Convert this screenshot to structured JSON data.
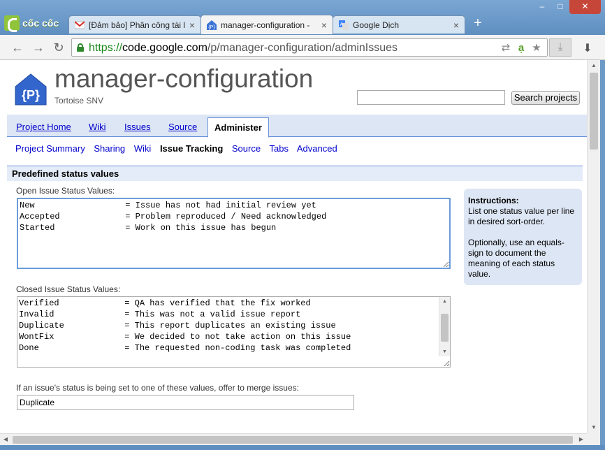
{
  "browser": {
    "logo_text": "cốc cốc",
    "tabs": [
      {
        "label": "[Đảm bảo] Phân công tài l",
        "icon": "gmail-icon"
      },
      {
        "label": "manager-configuration -",
        "icon": "google-code-icon"
      },
      {
        "label": "Google Dịch",
        "icon": "google-translate-icon"
      }
    ],
    "url_scheme": "https://",
    "url_host": "code.google.com",
    "url_path": "/p/manager-configuration/adminIssues"
  },
  "project": {
    "name": "manager-configuration",
    "summary": "Tortoise SNV",
    "search_button": "Search projects",
    "search_value": ""
  },
  "main_tabs": [
    "Project Home",
    "Wiki",
    "Issues",
    "Source",
    "Administer"
  ],
  "sub_nav": [
    "Project Summary",
    "Sharing",
    "Wiki",
    "Issue Tracking",
    "Source",
    "Tabs",
    "Advanced"
  ],
  "section": {
    "title": "Predefined status values",
    "open_label": "Open Issue Status Values:",
    "open_values": "New                  = Issue has not had initial review yet\nAccepted             = Problem reproduced / Need acknowledged\nStarted              = Work on this issue has begun",
    "closed_label": "Closed Issue Status Values:",
    "closed_values": "Verified             = QA has verified that the fix worked\nInvalid              = This was not a valid issue report\nDuplicate            = This report duplicates an existing issue\nWontFix              = We decided to not take action on this issue\nDone                 = The requested non-coding task was completed",
    "merge_label": "If an issue's status is being set to one of these values, offer to merge issues:",
    "merge_value": "Duplicate"
  },
  "instructions": {
    "heading": "Instructions:",
    "line1": "List one status value per line in desired sort-order.",
    "line2": "Optionally, use an equals-sign to document the meaning of each status value."
  }
}
